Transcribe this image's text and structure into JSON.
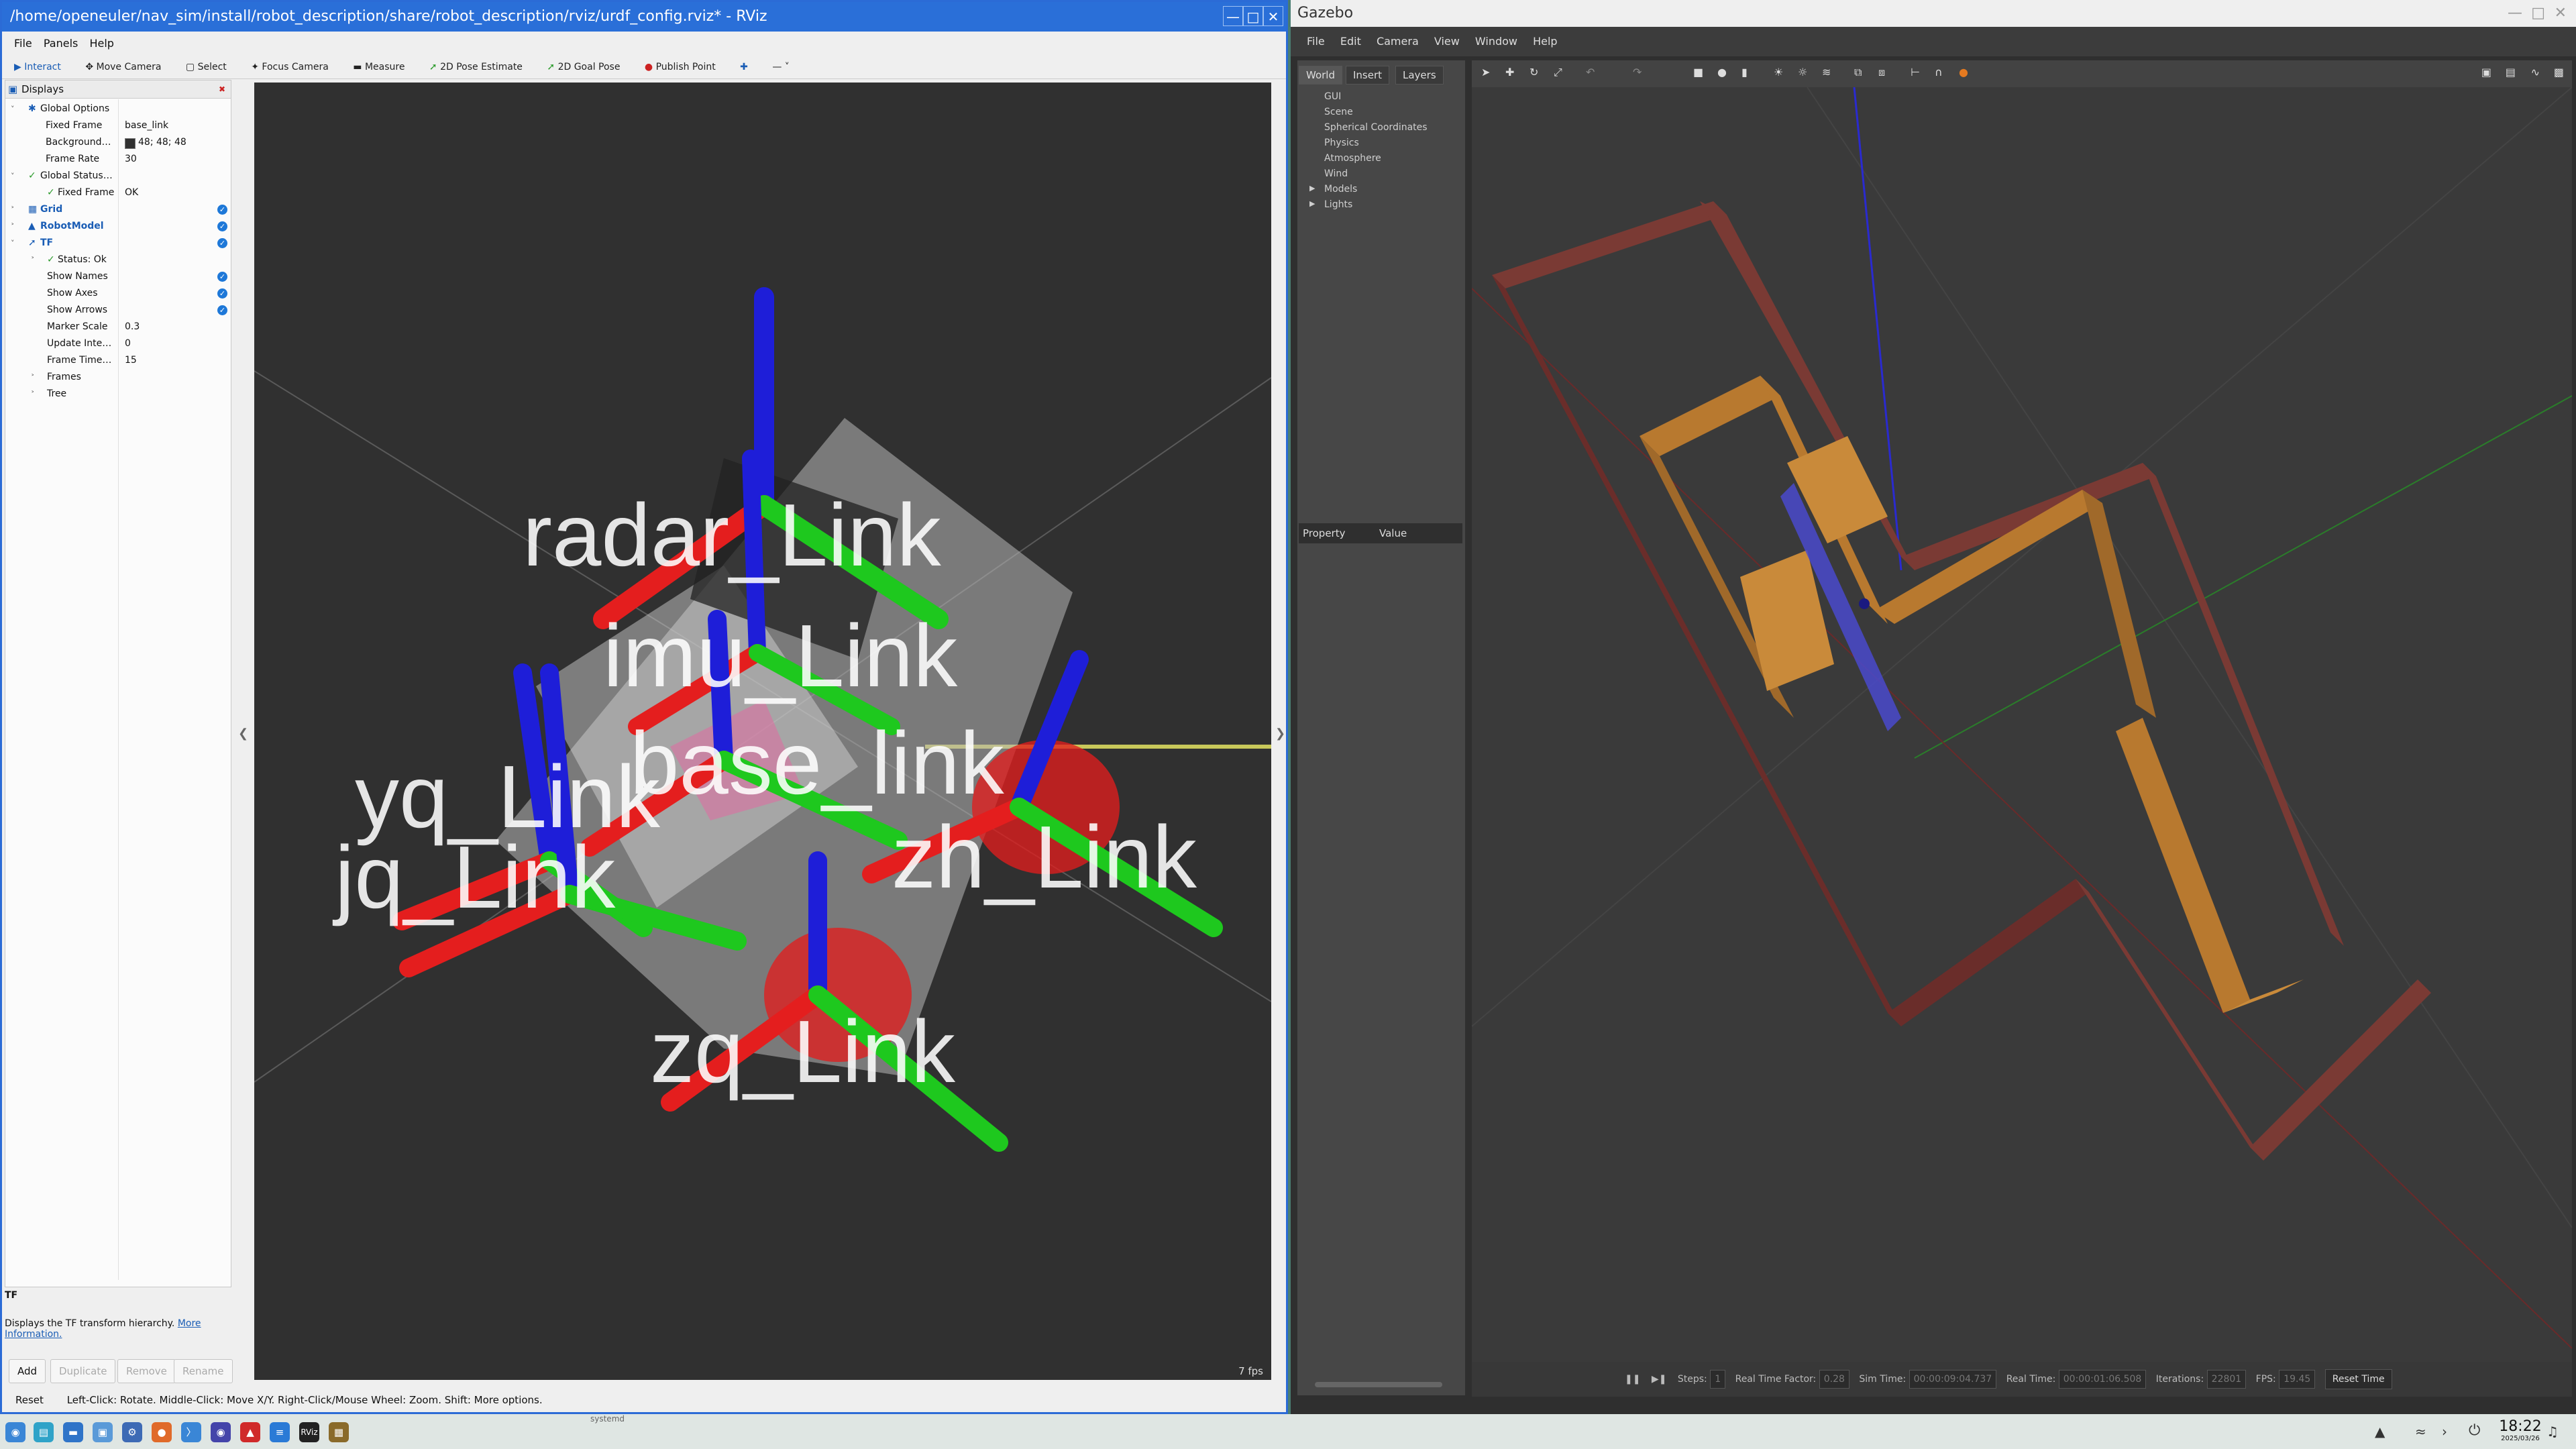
{
  "rviz": {
    "title": "/home/openeuler/nav_sim/install/robot_description/share/robot_description/rviz/urdf_config.rviz* - RViz",
    "menu": [
      "File",
      "Panels",
      "Help"
    ],
    "toolbar": [
      "Interact",
      "Move Camera",
      "Select",
      "Focus Camera",
      "Measure",
      "2D Pose Estimate",
      "2D Goal Pose",
      "Publish Point"
    ],
    "displays_title": "Displays",
    "tree": {
      "global_options": "Global Options",
      "fixed_frame_label": "Fixed Frame",
      "fixed_frame_value": "base_link",
      "background_label": "Background…",
      "background_value": "48; 48; 48",
      "frame_rate_label": "Frame Rate",
      "frame_rate_value": "30",
      "global_status": "Global Status…",
      "status_fixed_frame": "Fixed Frame",
      "status_fixed_frame_value": "OK",
      "grid": "Grid",
      "robot_model": "RobotModel",
      "tf": "TF",
      "tf_status": "Status: Ok",
      "show_names": "Show Names",
      "show_axes": "Show Axes",
      "show_arrows": "Show Arrows",
      "marker_scale_label": "Marker Scale",
      "marker_scale_value": "0.3",
      "update_interval_label": "Update Inte…",
      "update_interval_value": "0",
      "frame_timeout_label": "Frame Time…",
      "frame_timeout_value": "15",
      "frames": "Frames",
      "tree_node": "Tree"
    },
    "description_title": "TF",
    "description_text": "Displays the TF transform hierarchy.",
    "description_link": "More Information.",
    "panel_buttons": [
      "Add",
      "Duplicate",
      "Remove",
      "Rename"
    ],
    "reset": "Reset",
    "status_text": "Left-Click: Rotate. Middle-Click: Move X/Y. Right-Click/Mouse Wheel: Zoom. Shift: More options.",
    "fps": "7 fps",
    "frame_labels": [
      "radar_Link",
      "imu_Link",
      "base_link",
      "yq_Link",
      "jq_Link",
      "zh_Link",
      "zq_Link"
    ]
  },
  "gazebo": {
    "title": "Gazebo",
    "menu": [
      "File",
      "Edit",
      "Camera",
      "View",
      "Window",
      "Help"
    ],
    "tabs": [
      "World",
      "Insert",
      "Layers"
    ],
    "world_items": [
      "GUI",
      "Scene",
      "Spherical Coordinates",
      "Physics",
      "Atmosphere",
      "Wind",
      "Models",
      "Lights"
    ],
    "property_header": "Property",
    "value_header": "Value",
    "bottom": {
      "steps_label": "Steps:",
      "steps_value": "1",
      "rtf_label": "Real Time Factor:",
      "rtf_value": "0.28",
      "sim_time_label": "Sim Time:",
      "sim_time_value": "00:00:09:04.737",
      "real_time_label": "Real Time:",
      "real_time_value": "00:00:01:06.508",
      "iterations_label": "Iterations:",
      "iterations_value": "22801",
      "fps_label": "FPS:",
      "fps_value": "19.45",
      "reset_time": "Reset Time"
    }
  },
  "taskbar": {
    "clock": "18:22",
    "date": "2025/03/26",
    "behind_text": "systemd"
  },
  "colors": {
    "rviz_title_bg": "#2a6fd8",
    "axis_red": "#e41e1e",
    "axis_green": "#1ec81e",
    "axis_blue": "#1e1ed8",
    "viewport_bg": "#303030",
    "brick": "#7a3a34",
    "wood": "#b8792f"
  }
}
